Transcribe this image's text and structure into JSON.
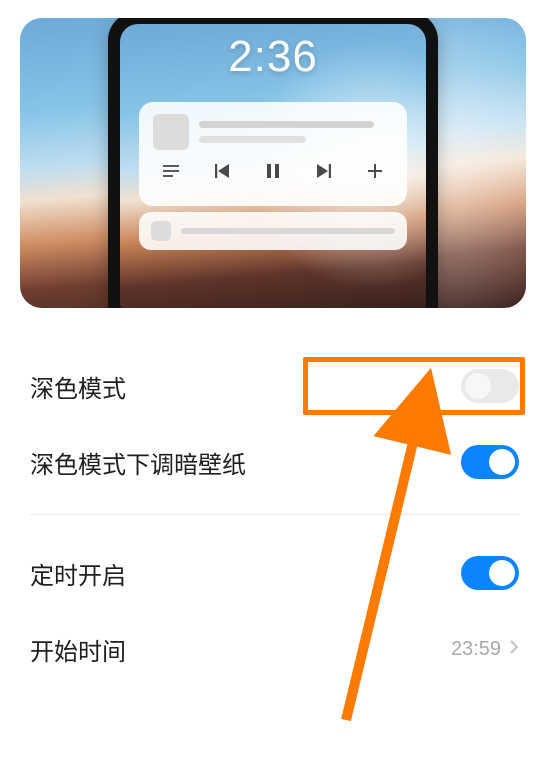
{
  "preview": {
    "clock": "2:36"
  },
  "settings": {
    "dark_mode": {
      "label": "深色模式",
      "on": false
    },
    "dim_wallpaper": {
      "label": "深色模式下调暗壁纸",
      "on": true
    },
    "schedule": {
      "label": "定时开启",
      "on": true
    },
    "start_time": {
      "label": "开始时间",
      "value": "23:59"
    }
  },
  "annotation": {
    "highlight_color": "#ff7a00"
  }
}
